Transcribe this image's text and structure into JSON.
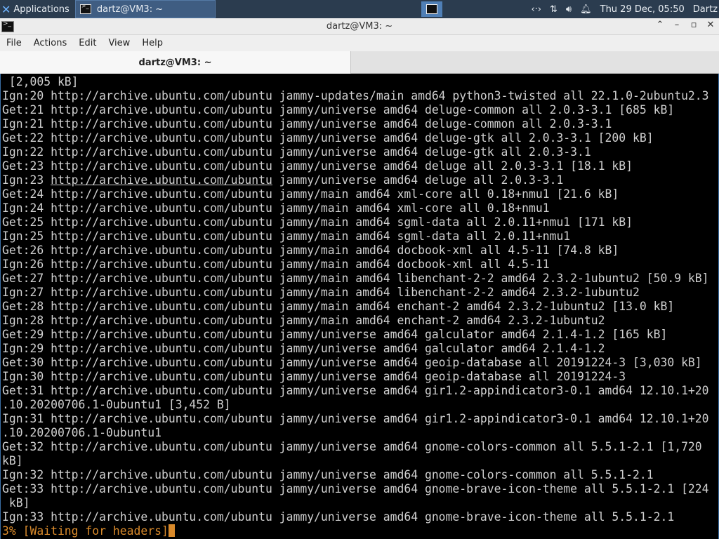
{
  "panel": {
    "applications_label": "Applications",
    "task_label": "dartz@VM3: ~",
    "clock": "Thu 29 Dec, 05:50",
    "user": "Dartz",
    "tray_icons": [
      "network-icon",
      "transfer-icon",
      "volume-icon",
      "notification-bell-icon"
    ]
  },
  "window": {
    "title": "dartz@VM3: ~",
    "menu": [
      "File",
      "Actions",
      "Edit",
      "View",
      "Help"
    ],
    "tab_label": "dartz@VM3: ~"
  },
  "terminal": {
    "lines": [
      " [2,005 kB]",
      "Ign:20 http://archive.ubuntu.com/ubuntu jammy-updates/main amd64 python3-twisted all 22.1.0-2ubuntu2.3",
      "Get:21 http://archive.ubuntu.com/ubuntu jammy/universe amd64 deluge-common all 2.0.3-3.1 [685 kB]",
      "Ign:21 http://archive.ubuntu.com/ubuntu jammy/universe amd64 deluge-common all 2.0.3-3.1",
      "Get:22 http://archive.ubuntu.com/ubuntu jammy/universe amd64 deluge-gtk all 2.0.3-3.1 [200 kB]",
      "Ign:22 http://archive.ubuntu.com/ubuntu jammy/universe amd64 deluge-gtk all 2.0.3-3.1",
      "Get:23 http://archive.ubuntu.com/ubuntu jammy/universe amd64 deluge all 2.0.3-3.1 [18.1 kB]",
      "Ign:23 http://archive.ubuntu.com/ubuntu jammy/universe amd64 deluge all 2.0.3-3.1",
      "Get:24 http://archive.ubuntu.com/ubuntu jammy/main amd64 xml-core all 0.18+nmu1 [21.6 kB]",
      "Ign:24 http://archive.ubuntu.com/ubuntu jammy/main amd64 xml-core all 0.18+nmu1",
      "Get:25 http://archive.ubuntu.com/ubuntu jammy/main amd64 sgml-data all 2.0.11+nmu1 [171 kB]",
      "Ign:25 http://archive.ubuntu.com/ubuntu jammy/main amd64 sgml-data all 2.0.11+nmu1",
      "Get:26 http://archive.ubuntu.com/ubuntu jammy/main amd64 docbook-xml all 4.5-11 [74.8 kB]",
      "Ign:26 http://archive.ubuntu.com/ubuntu jammy/main amd64 docbook-xml all 4.5-11",
      "Get:27 http://archive.ubuntu.com/ubuntu jammy/main amd64 libenchant-2-2 amd64 2.3.2-1ubuntu2 [50.9 kB]",
      "Ign:27 http://archive.ubuntu.com/ubuntu jammy/main amd64 libenchant-2-2 amd64 2.3.2-1ubuntu2",
      "Get:28 http://archive.ubuntu.com/ubuntu jammy/main amd64 enchant-2 amd64 2.3.2-1ubuntu2 [13.0 kB]",
      "Ign:28 http://archive.ubuntu.com/ubuntu jammy/main amd64 enchant-2 amd64 2.3.2-1ubuntu2",
      "Get:29 http://archive.ubuntu.com/ubuntu jammy/universe amd64 galculator amd64 2.1.4-1.2 [165 kB]",
      "Ign:29 http://archive.ubuntu.com/ubuntu jammy/universe amd64 galculator amd64 2.1.4-1.2",
      "Get:30 http://archive.ubuntu.com/ubuntu jammy/universe amd64 geoip-database all 20191224-3 [3,030 kB]",
      "Ign:30 http://archive.ubuntu.com/ubuntu jammy/universe amd64 geoip-database all 20191224-3",
      "Get:31 http://archive.ubuntu.com/ubuntu jammy/universe amd64 gir1.2-appindicator3-0.1 amd64 12.10.1+20",
      ".10.20200706.1-0ubuntu1 [3,452 B]",
      "Ign:31 http://archive.ubuntu.com/ubuntu jammy/universe amd64 gir1.2-appindicator3-0.1 amd64 12.10.1+20",
      ".10.20200706.1-0ubuntu1",
      "Get:32 http://archive.ubuntu.com/ubuntu jammy/universe amd64 gnome-colors-common all 5.5.1-2.1 [1,720",
      "kB]",
      "Ign:32 http://archive.ubuntu.com/ubuntu jammy/universe amd64 gnome-colors-common all 5.5.1-2.1",
      "Get:33 http://archive.ubuntu.com/ubuntu jammy/universe amd64 gnome-brave-icon-theme all 5.5.1-2.1 [224",
      " kB]",
      "Ign:33 http://archive.ubuntu.com/ubuntu jammy/universe amd64 gnome-brave-icon-theme all 5.5.1-2.1"
    ],
    "underlined_line_index": 7,
    "underlined_text": "http://archive.ubuntu.com/ubuntu",
    "status_line": "3% [Waiting for headers]",
    "status_color": "#d98a2b"
  }
}
